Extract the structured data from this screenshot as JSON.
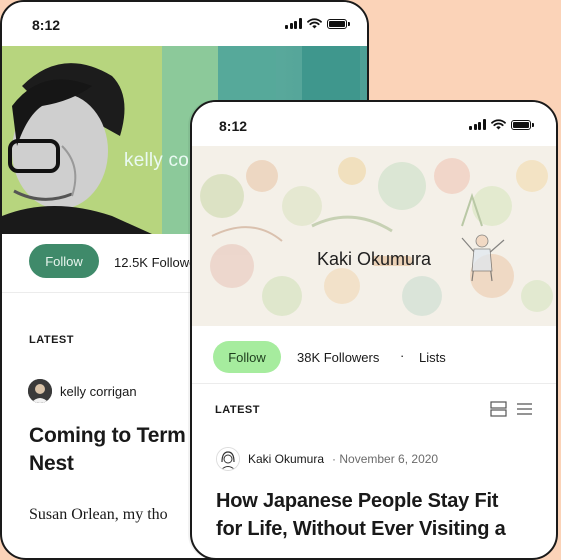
{
  "back_phone": {
    "status_time": "8:12",
    "header_name": "kelly co",
    "follow_label": "Follow",
    "followers_text": "12.5K Followe",
    "latest_label": "LATEST",
    "author_name": "kelly corrigan",
    "post_title": "Coming to Term Nest",
    "post_title_line1": "Coming to Term",
    "post_title_line2": "Nest",
    "excerpt": "Susan Orlean, my tho"
  },
  "front_phone": {
    "status_time": "8:12",
    "header_name": "Kaki Okumura",
    "follow_label": "Follow",
    "followers_text": "38K Followers",
    "separator": "·",
    "lists_label": "Lists",
    "latest_label": "LATEST",
    "author_name": "Kaki Okumura",
    "post_date": "· November 6, 2020",
    "post_title_line1": "How Japanese People Stay Fit",
    "post_title_line2": "for Life, Without Ever Visiting a"
  },
  "icons": {
    "signal": "signal-icon",
    "wifi": "wifi-icon",
    "battery": "battery-icon",
    "card_view": "card-view-icon",
    "list_view": "list-view-icon"
  },
  "colors": {
    "background": "#fbd3b8",
    "back_follow_button": "#3f8a6a",
    "front_follow_button": "#a6ec9e",
    "back_header_teal": "#4e9f95"
  }
}
